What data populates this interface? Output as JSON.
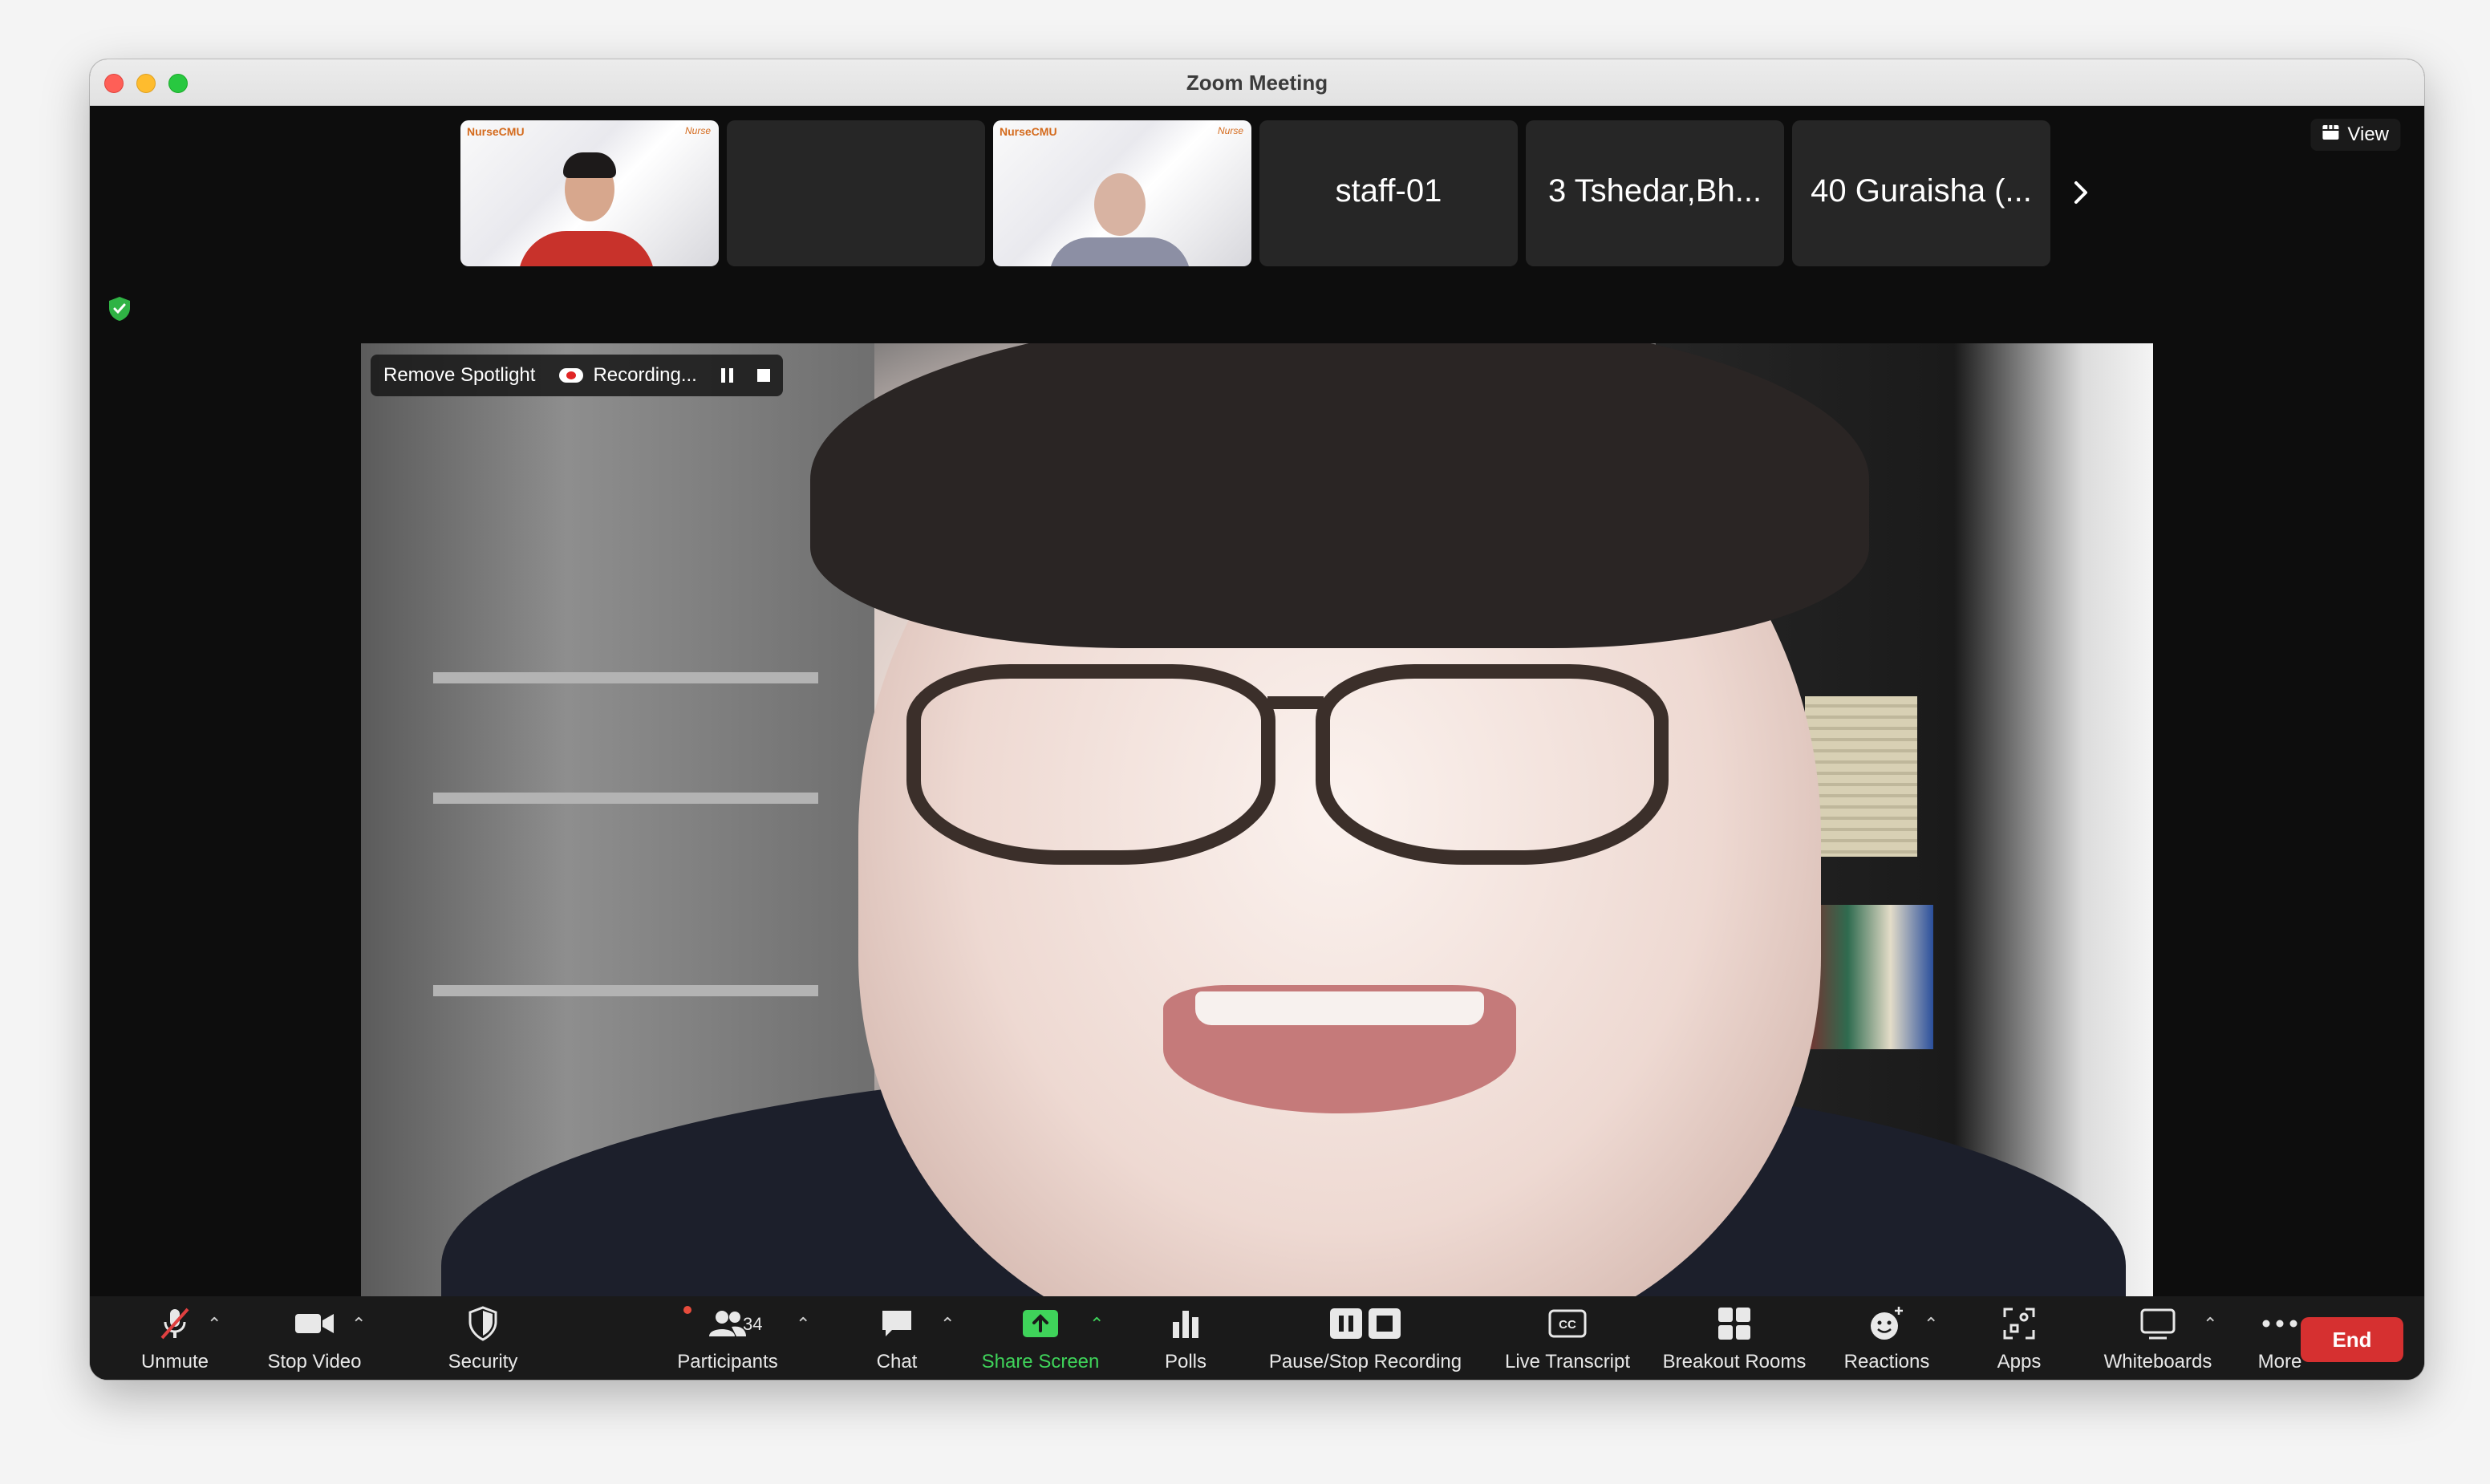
{
  "window": {
    "title": "Zoom Meeting"
  },
  "gallery": {
    "tiles": [
      {
        "type": "video",
        "brand_left": "NurseCMU",
        "brand_right": "Nurse",
        "name": ""
      },
      {
        "type": "blank",
        "name": ""
      },
      {
        "type": "video",
        "brand_left": "NurseCMU",
        "brand_right": "Nurse",
        "name": ""
      },
      {
        "type": "name",
        "name": "staff-01"
      },
      {
        "type": "name",
        "name": "3 Tshedar,Bh..."
      },
      {
        "type": "name",
        "name": "40 Guraisha (..."
      }
    ],
    "next_icon": "chevron-right-icon"
  },
  "view_button": {
    "label": "View",
    "icon": "grid-icon"
  },
  "spotlight_bar": {
    "remove_label": "Remove Spotlight",
    "recording_label": "Recording..."
  },
  "toolbar": {
    "unmute": "Unmute",
    "stop_video": "Stop Video",
    "security": "Security",
    "participants": "Participants",
    "participants_count": "34",
    "chat": "Chat",
    "share_screen": "Share Screen",
    "polls": "Polls",
    "pause_stop_recording": "Pause/Stop Recording",
    "live_transcript": "Live Transcript",
    "breakout_rooms": "Breakout Rooms",
    "reactions": "Reactions",
    "apps": "Apps",
    "whiteboards": "Whiteboards",
    "more": "More",
    "end": "End"
  },
  "colors": {
    "share_green": "#3fd35a",
    "end_red": "#d63030",
    "shield_green": "#2fb344",
    "recording_red": "#e02424"
  }
}
